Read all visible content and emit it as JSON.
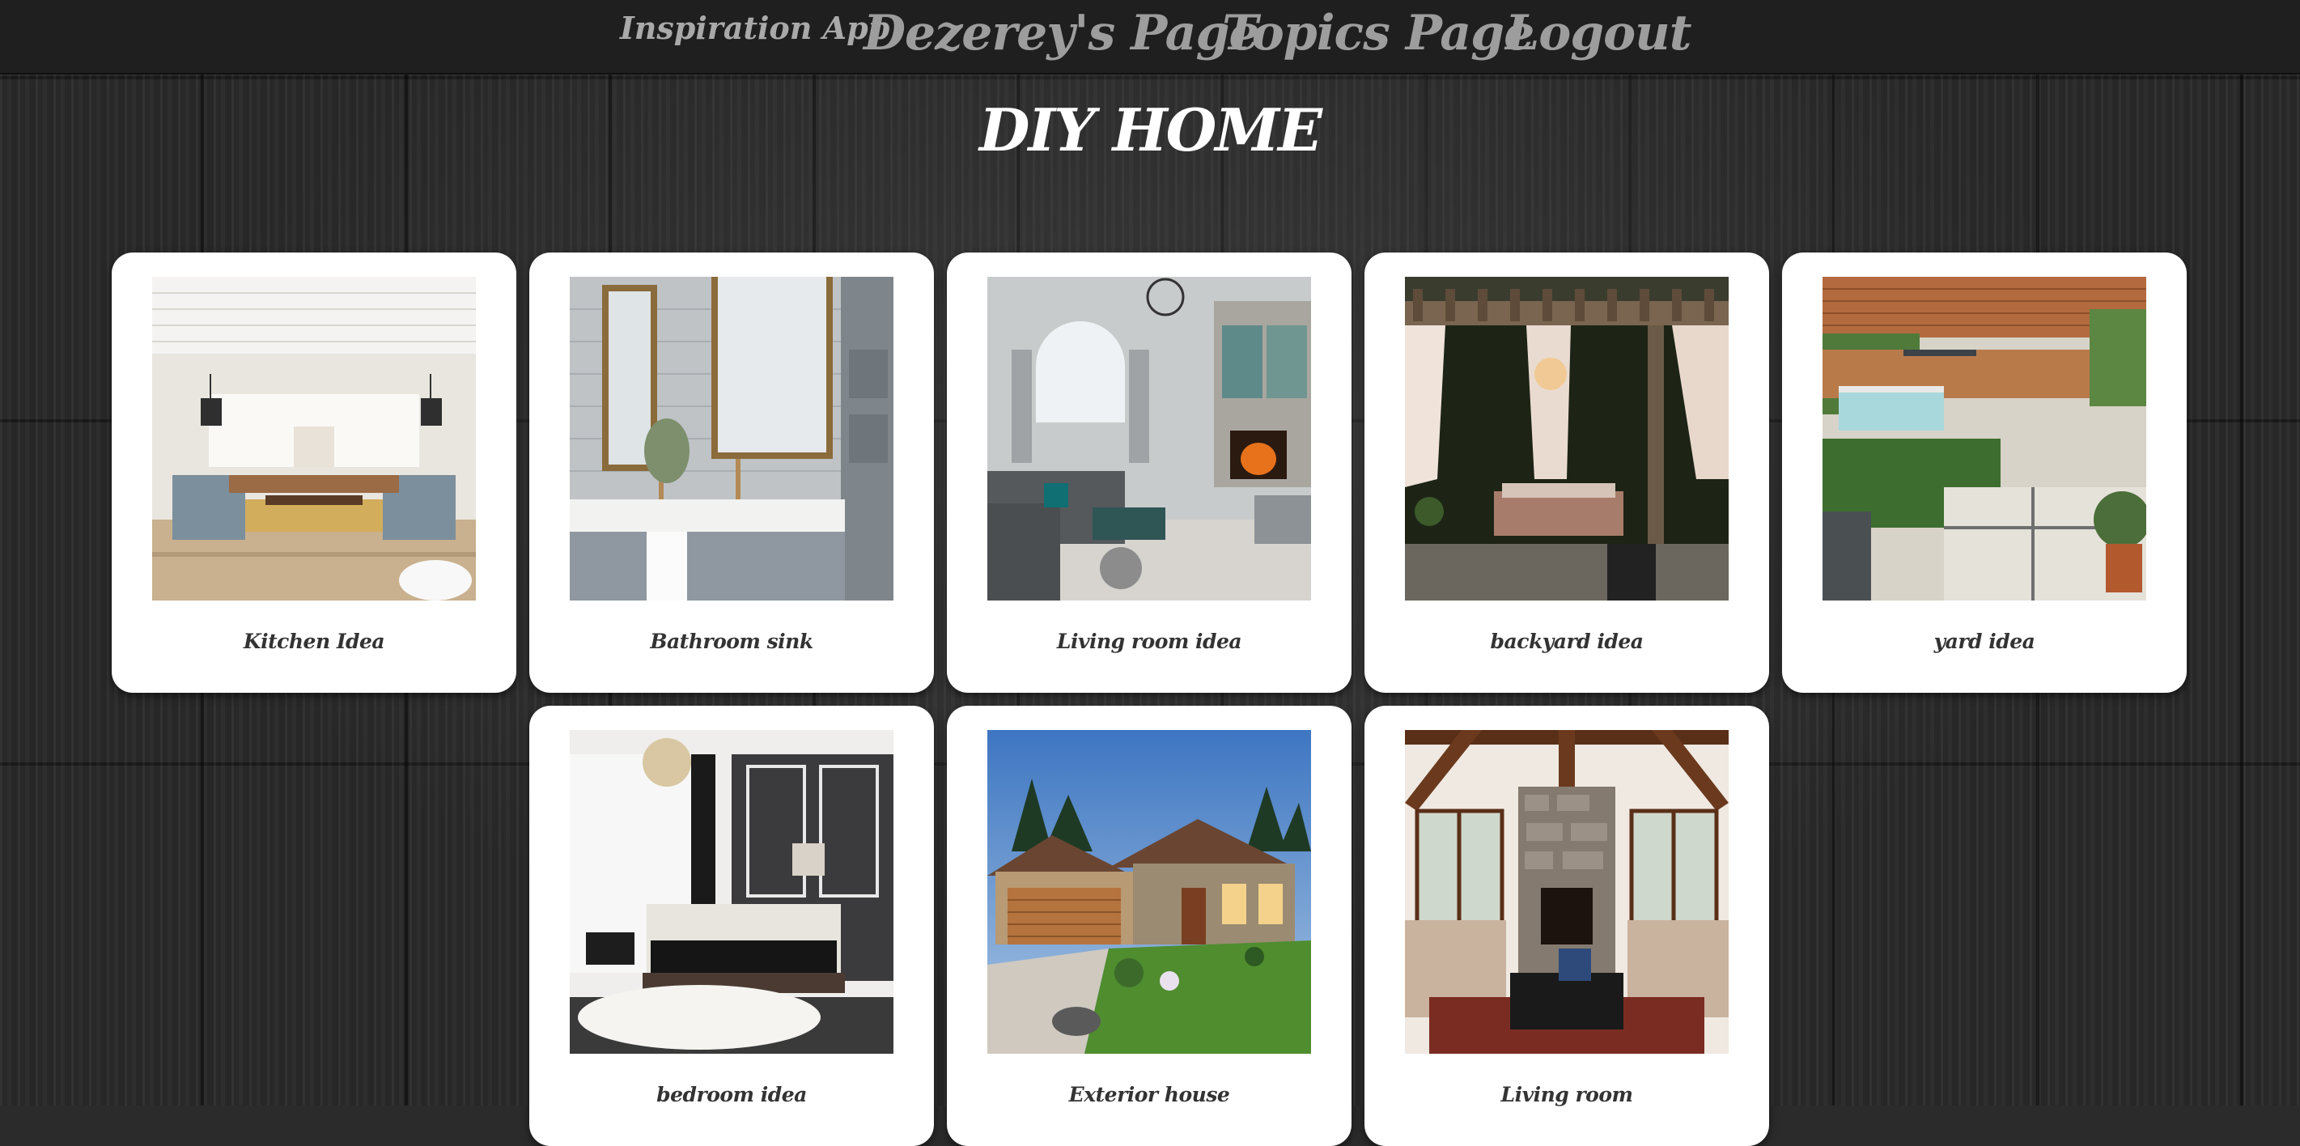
{
  "nav": {
    "brand": "Inspiration App",
    "links": [
      "Dezerey's Page",
      "Topics Page",
      "Logout"
    ]
  },
  "page": {
    "title": "DIY HOME"
  },
  "cards": [
    {
      "caption": "Kitchen Idea"
    },
    {
      "caption": "Bathroom sink"
    },
    {
      "caption": "Living room idea"
    },
    {
      "caption": "backyard idea"
    },
    {
      "caption": "yard idea"
    },
    {
      "caption": "bedroom idea"
    },
    {
      "caption": "Exterior house"
    },
    {
      "caption": "Living room"
    }
  ]
}
